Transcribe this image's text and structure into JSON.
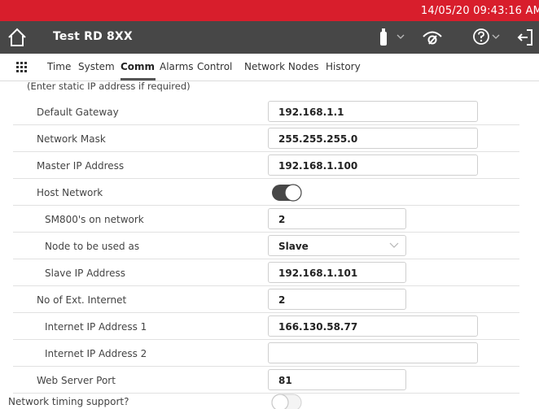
{
  "status_bar": {
    "datetime": "14/05/20 09:43:16 AM"
  },
  "header": {
    "title": "Test RD 8XX"
  },
  "nav": {
    "tabs": [
      {
        "label": "Time"
      },
      {
        "label": "System"
      },
      {
        "label": "Comm",
        "active": true
      },
      {
        "label": "Alarms"
      },
      {
        "label": "Control"
      },
      {
        "label": "Network Nodes"
      },
      {
        "label": "History"
      }
    ]
  },
  "form": {
    "hint": "(Enter static IP address if required)",
    "default_gateway": {
      "label": "Default Gateway",
      "value": "192.168.1.1"
    },
    "network_mask": {
      "label": "Network Mask",
      "value": "255.255.255.0"
    },
    "master_ip": {
      "label": "Master IP Address",
      "value": "192.168.1.100"
    },
    "host_network": {
      "label": "Host Network",
      "enabled": true
    },
    "sm800_count": {
      "label": "SM800's on network",
      "value": "2"
    },
    "node_role": {
      "label": "Node to be used as",
      "value": "Slave"
    },
    "slave_ip": {
      "label": "Slave IP Address",
      "value": "192.168.1.101"
    },
    "ext_internet_count": {
      "label": "No of Ext. Internet",
      "value": "2"
    },
    "internet_ip_1": {
      "label": "Internet IP Address 1",
      "value": "166.130.58.77"
    },
    "internet_ip_2": {
      "label": "Internet IP Address 2",
      "value": ""
    },
    "web_server_port": {
      "label": "Web Server Port",
      "value": "81"
    },
    "network_timing": {
      "label": "Network timing support?",
      "enabled": false
    }
  },
  "colors": {
    "status_bar": "#d81e2c",
    "header": "#474747",
    "toggle_on": "#474747"
  }
}
